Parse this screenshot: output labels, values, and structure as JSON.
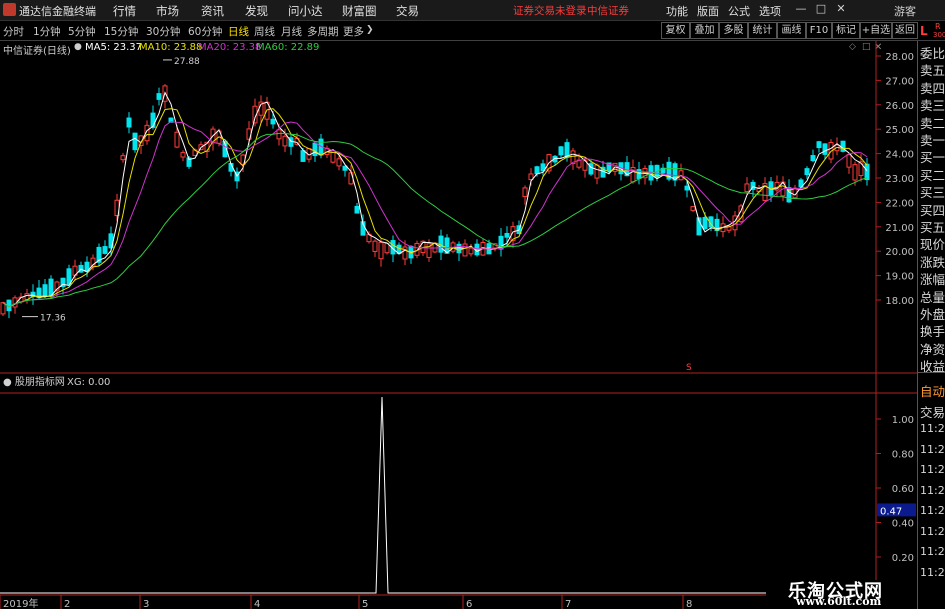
{
  "app": {
    "title": "通达信金融终端",
    "login_status": "证券交易未登录",
    "broker": "中信证券",
    "guest": "游客"
  },
  "menus": [
    "行情",
    "市场",
    "资讯",
    "发现",
    "问小达",
    "财富圈",
    "交易"
  ],
  "right_menus": [
    "功能",
    "版面",
    "公式",
    "选项"
  ],
  "window_buttons": {
    "minimize": "—",
    "restore": "□",
    "close": "✕"
  },
  "periods": [
    "分时",
    "1分钟",
    "5分钟",
    "15分钟",
    "30分钟",
    "60分钟",
    "日线",
    "周线",
    "月线",
    "多周期",
    "更多"
  ],
  "active_period": "日线",
  "more_arrow": "❯",
  "tool_buttons": [
    "复权",
    "叠加",
    "多股",
    "统计",
    "画线",
    "F10",
    "标记",
    "+自选",
    "返回"
  ],
  "corner": {
    "L": "L",
    "R": "R",
    "code": "300"
  },
  "main_chart": {
    "stock_label": "中信证券(日线)",
    "ma5": "MA5: 23.37",
    "ma10": "MA10: 23.88",
    "ma20": "MA20: 23.38",
    "ma60": "MA60: 22.89",
    "colors": {
      "ma5": "#ffffff",
      "ma10": "#e8e000",
      "ma20": "#d033d0",
      "ma60": "#2ecc40",
      "up": "#ff3c3c",
      "down": "#00e5ee",
      "axis": "#b02020"
    },
    "high_label": "27.88",
    "low_label": "17.36",
    "s_marker": "S",
    "y_ticks": [
      "28.00",
      "27.00",
      "26.00",
      "25.00",
      "24.00",
      "23.00",
      "22.00",
      "21.00",
      "20.00",
      "19.00",
      "18.00"
    ]
  },
  "indicator": {
    "name": "股朋指标网",
    "xg": "XG: 0.00",
    "y_ticks": [
      "1.00",
      "0.80",
      "0.60",
      "0.40",
      "0.20"
    ],
    "current_value": "0.47"
  },
  "x_labels": [
    "2019年",
    "2",
    "3",
    "4",
    "5",
    "6",
    "7",
    "8"
  ],
  "side_panel": [
    "委比",
    "卖五",
    "卖四",
    "卖三",
    "卖二",
    "卖一",
    "买一",
    "买二",
    "买三",
    "买四",
    "买五",
    "现价",
    "涨跌",
    "涨幅",
    "总量",
    "外盘",
    "换手",
    "净资",
    "收益"
  ],
  "side_bottom": [
    "自动",
    "交易",
    "11:29",
    "11:29",
    "11:29",
    "11:29",
    "11:29",
    "11:29",
    "11:29",
    "11:29"
  ],
  "watermark": {
    "title": "乐淘公式网",
    "url": "www.60lt.com"
  },
  "chart_data": {
    "type": "candlestick",
    "y_range": [
      17,
      28.5
    ],
    "ma_values": {
      "MA5": 23.37,
      "MA10": 23.88,
      "MA20": 23.38,
      "MA60": 22.89
    },
    "annotations": [
      {
        "label": "27.88",
        "kind": "high"
      },
      {
        "label": "17.36",
        "kind": "low"
      }
    ],
    "indicator": {
      "name": "XG",
      "value": 0.0,
      "y_range": [
        0,
        1
      ],
      "spike_at_month": "5"
    }
  }
}
